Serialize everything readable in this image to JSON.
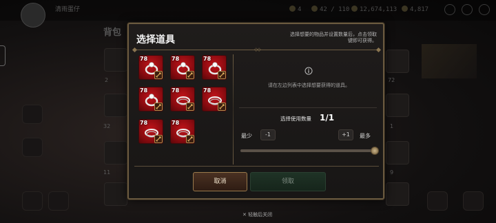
{
  "background": {
    "player_name": "清雨蛋仔",
    "player_sub": "",
    "resources": [
      "4",
      "42 / 110",
      "12,674,113",
      "4,817"
    ],
    "bag_title": "背包",
    "slot_counts": [
      "2",
      "32",
      "11",
      "72",
      "1",
      "9"
    ]
  },
  "modal": {
    "title": "选择道具",
    "hint": "选择想要的物品并设置数量后，点击领取键即可获得。",
    "items": [
      {
        "level": "78",
        "kind": "ring"
      },
      {
        "level": "78",
        "kind": "ring"
      },
      {
        "level": "78",
        "kind": "ring"
      },
      {
        "level": "78",
        "kind": "ring"
      },
      {
        "level": "78",
        "kind": "bracelet"
      },
      {
        "level": "78",
        "kind": "bracelet"
      },
      {
        "level": "78",
        "kind": "bracelet"
      },
      {
        "level": "78",
        "kind": "bracelet"
      }
    ],
    "empty_text": "请在左边列表中选择想要获得的道具。",
    "count_label": "选择使用数量",
    "count_value": "1/1",
    "min_label": "最少",
    "minus_label": "-1",
    "plus_label": "+1",
    "max_label": "最多",
    "slider_fraction": 1.0,
    "cancel_label": "取消",
    "confirm_label": "领取"
  },
  "tap_close": "✕ 轻触后关闭",
  "colors": {
    "item_bg": "#b0121a",
    "border_gold": "#6b5a3f",
    "cancel_border": "#9a7a4c",
    "confirm_bg": "#1f3326"
  },
  "icons": [
    "info-icon",
    "sword-icon",
    "ring-icon",
    "bracelet-icon",
    "close-icon"
  ]
}
